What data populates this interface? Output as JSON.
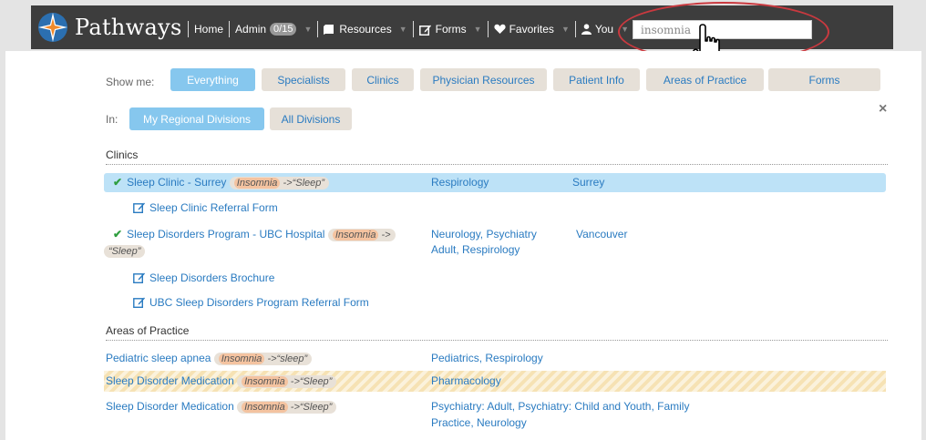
{
  "nav": {
    "brand": "Pathways",
    "home": "Home",
    "admin": "Admin",
    "admin_badge": "0/15",
    "resources": "Resources",
    "forms": "Forms",
    "favorites": "Favorites",
    "you": "You",
    "search_value": "insomnia"
  },
  "filters": {
    "show_me_label": "Show me:",
    "types": [
      "Everything",
      "Specialists",
      "Clinics",
      "Physician Resources",
      "Patient Info",
      "Areas of Practice",
      "Forms"
    ],
    "active_type": "Everything",
    "in_label": "In:",
    "divisions": [
      "My Regional Divisions",
      "All Divisions"
    ],
    "active_division": "My Regional Divisions",
    "close": "×"
  },
  "clinics": {
    "title": "Clinics",
    "rows": [
      {
        "name": "Sleep Clinic - Surrey",
        "match": "Insomnia",
        "synonym": " ->“Sleep”",
        "specialty": "Respirology",
        "city": "Surrey"
      },
      {
        "form": "Sleep Clinic Referral Form"
      },
      {
        "name": "Sleep Disorders Program - UBC Hospital",
        "match": "Insomnia",
        "synonym_a": " ->",
        "synonym_b": "“Sleep”",
        "specialty_a": "Neurology, Psychiatry",
        "specialty_b": "Adult, Respirology",
        "city": "Vancouver"
      },
      {
        "form": "Sleep Disorders Brochure"
      },
      {
        "form": "UBC Sleep Disorders Program Referral Form"
      }
    ]
  },
  "areas": {
    "title": "Areas of Practice",
    "rows": [
      {
        "name": "Pediatric sleep apnea",
        "match": "Insomnia",
        "synonym": " ->“sleep”",
        "specialty": "Pediatrics, Respirology"
      },
      {
        "name": "Sleep Disorder Medication",
        "match": "Insomnia",
        "synonym": " ->“Sleep”",
        "specialty": "Pharmacology"
      },
      {
        "name": "Sleep Disorder Medication",
        "match": "Insomnia",
        "synonym": " ->“Sleep”",
        "specialty_a": "Psychiatry: Adult, Psychiatry: Child and Youth, Family",
        "specialty_b": "Practice, Neurology"
      }
    ]
  }
}
